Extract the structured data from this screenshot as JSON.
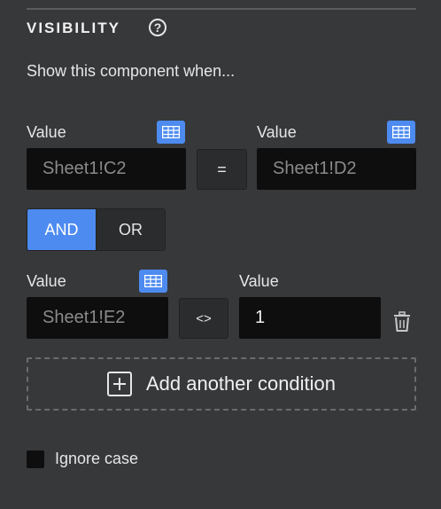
{
  "section": {
    "title": "VISIBILITY",
    "help_glyph": "?",
    "subtitle": "Show this component when..."
  },
  "condition1": {
    "left_label": "Value",
    "left_value": "Sheet1!C2",
    "operator": "=",
    "right_label": "Value",
    "right_value": "Sheet1!D2"
  },
  "logic": {
    "options": [
      "AND",
      "OR"
    ],
    "selected": "AND"
  },
  "condition2": {
    "left_label": "Value",
    "left_value": "Sheet1!E2",
    "operator": "<>",
    "right_label": "Value",
    "right_value": "1"
  },
  "add_condition_label": "Add another condition",
  "ignore_case": {
    "label": "Ignore case",
    "checked": false
  },
  "icons": {
    "help": "help-circle-icon",
    "table": "table-icon",
    "trash": "trash-icon",
    "plus": "plus-box-icon"
  },
  "colors": {
    "accent": "#4d8bf0",
    "background": "#37383a",
    "field_bg": "#0e0e0f"
  }
}
